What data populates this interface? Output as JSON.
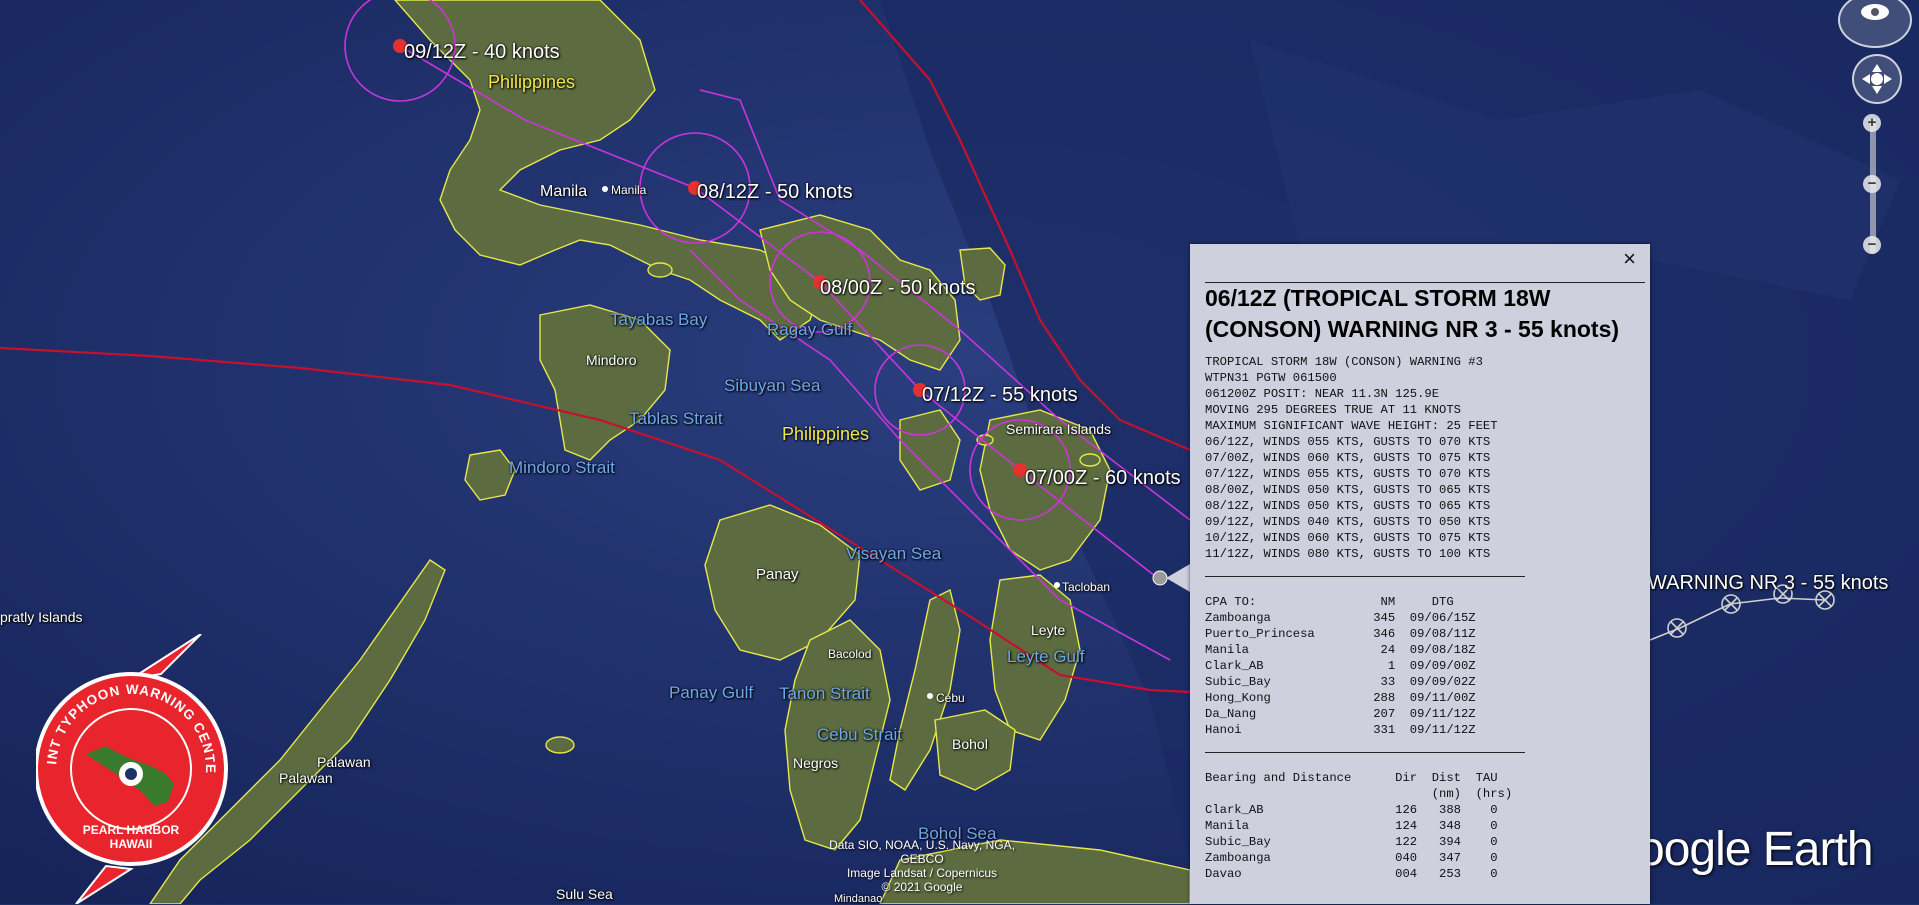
{
  "map": {
    "colors": {
      "ocean": "#1d3068",
      "land": "#5b6b3f",
      "coast": "#e6e84a",
      "track": "#cc33dd",
      "boundary": "#c8102e"
    },
    "forecast_fixes": [
      {
        "label": "09/12Z - 40 knots"
      },
      {
        "label": "08/12Z - 50 knots"
      },
      {
        "label": "08/00Z - 50 knots"
      },
      {
        "label": "07/12Z - 55 knots"
      },
      {
        "label": "07/00Z - 60 knots"
      },
      {
        "label": "WARNING NR 3 - 55 knots"
      }
    ],
    "places": {
      "philippines_north": "Philippines",
      "philippines_south": "Philippines",
      "manila_label": "Manila",
      "manila_pin": "Manila",
      "tayabas_bay": "Tayabas Bay",
      "ragay_gulf": "Ragay Gulf",
      "mindoro": "Mindoro",
      "sibuyan_sea": "Sibuyan Sea",
      "tablas_strait": "Tablas Strait",
      "mindoro_strait": "Mindoro Strait",
      "semirara_islands": "Semirara Islands",
      "panay": "Panay",
      "visayan_sea": "Visayan Sea",
      "tacloban": "Tacloban",
      "leyte": "Leyte",
      "leyte_gulf": "Leyte Gulf",
      "bacolod": "Bacolod",
      "panay_gulf": "Panay Gulf",
      "tanon_strait": "Tanon Strait",
      "cebu": "Cebu",
      "cebu_strait": "Cebu Strait",
      "negros": "Negros",
      "bohol": "Bohol",
      "bohol_sea": "Bohol Sea",
      "spratly_islands": "pratly Islands",
      "palawan_town": "Palawan",
      "palawan_island": "Palawan",
      "sulu_sea": "Sulu Sea",
      "mindanao": "Mindanao"
    },
    "attribution": [
      "Data SIO, NOAA, U.S. Navy, NGA, GEBCO",
      "Image Landsat / Copernicus",
      "© 2021 Google"
    ],
    "logo_text": "oogle Earth"
  },
  "jtwc_logo": {
    "top_text": "JOINT TYPHOON WARNING CENTER",
    "bottom_text_1": "PEARL HARBOR",
    "bottom_text_2": "HAWAII"
  },
  "controls": {
    "zoom_in": "+",
    "zoom_out": "−"
  },
  "popup": {
    "close_label": "×",
    "title": "06/12Z (TROPICAL STORM 18W (CONSON) WARNING NR 3 - 55 knots)",
    "warning_text": "TROPICAL STORM 18W (CONSON) WARNING #3\nWTPN31 PGTW 061500\n061200Z POSIT: NEAR 11.3N 125.9E\nMOVING 295 DEGREES TRUE AT 11 KNOTS\nMAXIMUM SIGNIFICANT WAVE HEIGHT: 25 FEET\n06/12Z, WINDS 055 KTS, GUSTS TO 070 KTS\n07/00Z, WINDS 060 KTS, GUSTS TO 075 KTS\n07/12Z, WINDS 055 KTS, GUSTS TO 070 KTS\n08/00Z, WINDS 050 KTS, GUSTS TO 065 KTS\n08/12Z, WINDS 050 KTS, GUSTS TO 065 KTS\n09/12Z, WINDS 040 KTS, GUSTS TO 050 KTS\n10/12Z, WINDS 060 KTS, GUSTS TO 075 KTS\n11/12Z, WINDS 080 KTS, GUSTS TO 100 KTS",
    "cpa_text": "CPA TO:                 NM     DTG\nZamboanga              345  09/06/15Z\nPuerto_Princesa        346  09/08/11Z\nManila                  24  09/08/18Z\nClark_AB                 1  09/09/00Z\nSubic_Bay               33  09/09/02Z\nHong_Kong              288  09/11/00Z\nDa_Nang                207  09/11/12Z\nHanoi                  331  09/11/12Z",
    "bearing_text": "Bearing and Distance      Dir  Dist  TAU\n                               (nm)  (hrs)\nClark_AB                  126   388    0\nManila                    124   348    0\nSubic_Bay                 122   394    0\nZamboanga                 040   347    0\nDavao                     004   253    0"
  }
}
